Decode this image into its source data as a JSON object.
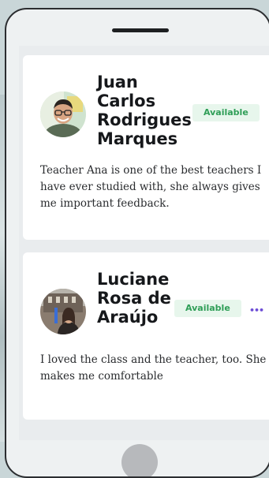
{
  "reviews": [
    {
      "name": "Juan Carlos Rodrigues Marques",
      "status": "Available",
      "text": "Teacher Ana is one of the best teachers I have ever studied with, she always gives me important feedback."
    },
    {
      "name": "Luciane Rosa de Araújo",
      "status": "Available",
      "text": "I loved the class and the teacher, too. She makes me comfortable"
    }
  ],
  "icons": {
    "more": "more-horizontal-icon"
  }
}
